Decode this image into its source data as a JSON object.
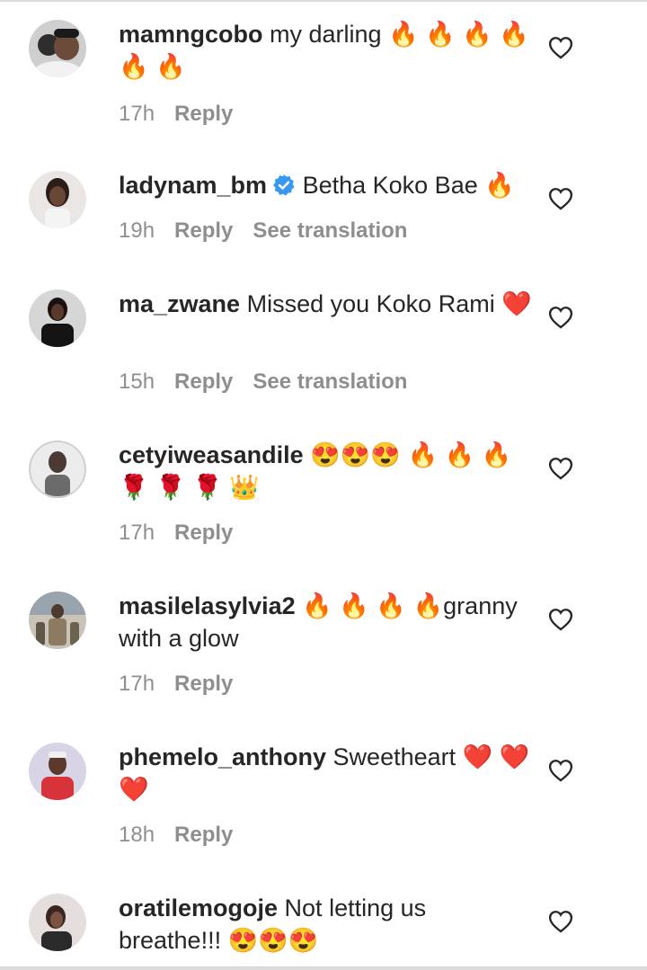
{
  "comments": [
    {
      "username": "mamngcobo",
      "text": "my darling 🔥 🔥 🔥 🔥 🔥 🔥",
      "time": "17h",
      "reply": "Reply",
      "translate": "",
      "verified": false,
      "avatar_color": "#3a3a3a"
    },
    {
      "username": "ladynam_bm",
      "text": "Betha Koko Bae 🔥",
      "time": "19h",
      "reply": "Reply",
      "translate": "See translation",
      "verified": true,
      "avatar_color": "#7a6a60"
    },
    {
      "username": "ma_zwane",
      "text": "Missed you Koko Rami ❤️",
      "time": "15h",
      "reply": "Reply",
      "translate": "See translation",
      "verified": false,
      "avatar_color": "#1e1e1e"
    },
    {
      "username": "cetyiweasandile",
      "text": "😍😍😍 🔥 🔥 🔥 🌹 🌹 🌹 👑",
      "time": "17h",
      "reply": "Reply",
      "translate": "",
      "verified": false,
      "avatar_color": "#d8d8d8"
    },
    {
      "username": "masilelasylvia2",
      "text": "🔥 🔥 🔥 🔥granny with a glow",
      "time": "17h",
      "reply": "Reply",
      "translate": "",
      "verified": false,
      "avatar_color": "#8a7f6e"
    },
    {
      "username": "phemelo_anthony",
      "text": "Sweetheart ❤️ ❤️❤️",
      "time": "18h",
      "reply": "Reply",
      "translate": "",
      "verified": false,
      "avatar_color": "#c7c0d8"
    },
    {
      "username": "oratilemogoje",
      "text": "Not letting us breathe!!! 😍😍😍",
      "time": "",
      "reply": "",
      "translate": "",
      "verified": false,
      "avatar_color": "#b0a9a8"
    }
  ],
  "colors": {
    "text": "#262626",
    "secondary": "#8e8e8e",
    "verified_blue": "#3897f0",
    "divider": "#dcdcdc"
  },
  "icons": {
    "like": "heart-outline-icon",
    "verified": "verified-badge-icon"
  }
}
